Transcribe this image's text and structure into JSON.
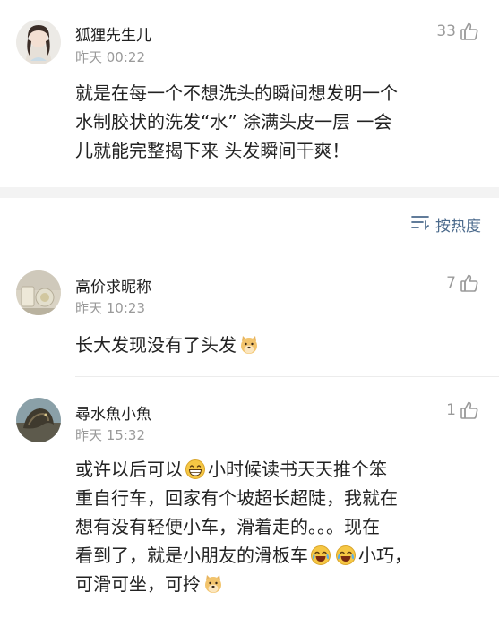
{
  "top_comment": {
    "username": "狐狸先生儿",
    "time": "昨天 00:22",
    "likes": "33",
    "lines": [
      "就是在每一个不想洗头的瞬间想发明一个",
      "水制胶状的洗发“水” 涂满头皮一层 一会",
      "儿就能完整揭下来 头发瞬间干爽！"
    ]
  },
  "sort": {
    "label": "按热度"
  },
  "comments": [
    {
      "username": "高价求昵称",
      "time": "昨天 10:23",
      "likes": "7",
      "text": "长大发现没有了头发"
    },
    {
      "username": "尋水魚小魚",
      "time": "昨天 15:32",
      "likes": "1",
      "line1_a": "或许以后可以",
      "line1_b": "小时候读书天天推个笨",
      "line2": "重自行车，回家有个坡超长超陡，我就在",
      "line3": "想有没有轻便小车，滑着走的。。。现在",
      "line4_a": "看到了，就是小朋友的滑板车",
      "line4_b": "小巧，",
      "line5": "可滑可坐，可拎"
    }
  ],
  "colors": {
    "link": "#4b6a8c",
    "meta": "#9a9a9a",
    "band": "#f3f3f3",
    "emoji": "#f6c744"
  },
  "icons": [
    "thumbs-up-icon",
    "sort-icon",
    "doge-emoji",
    "grin-emoji",
    "laugh-cry-emoji"
  ]
}
